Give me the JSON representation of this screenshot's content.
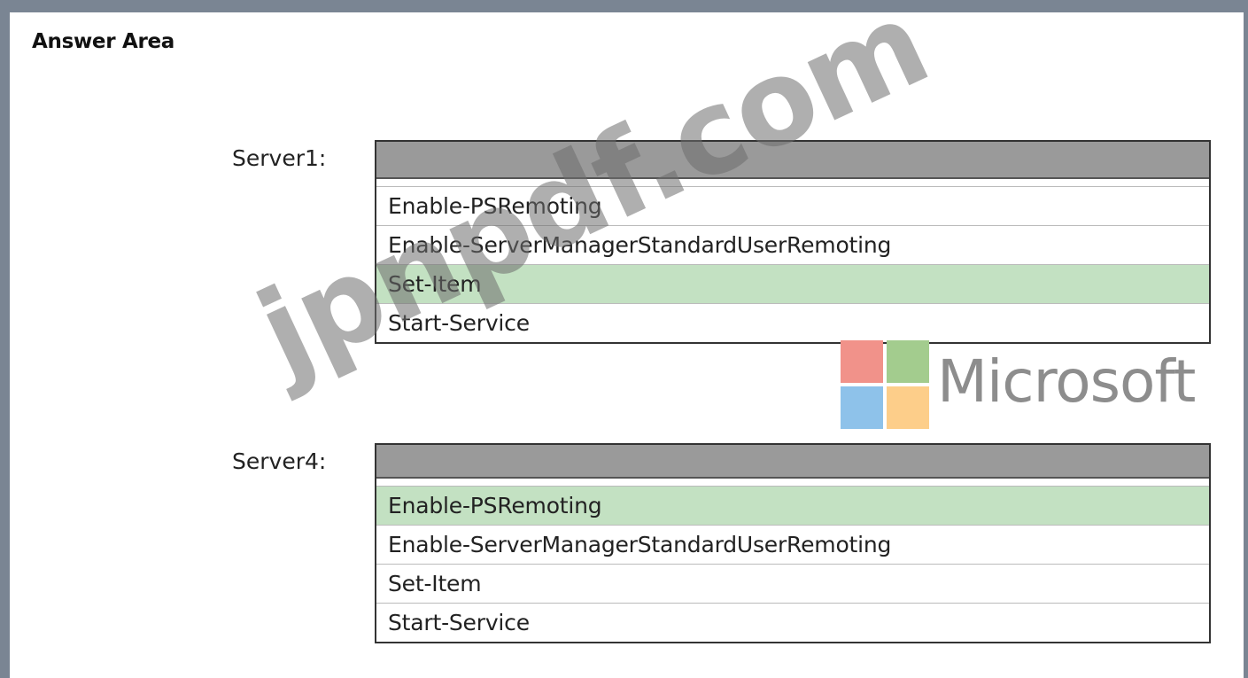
{
  "title": "Answer Area",
  "server1": {
    "label": "Server1:",
    "options": [
      "Enable-PSRemoting",
      "Enable-ServerManagerStandardUserRemoting",
      "Set-Item",
      "Start-Service"
    ],
    "selected_index": 2
  },
  "server4": {
    "label": "Server4:",
    "options": [
      "Enable-PSRemoting",
      "Enable-ServerManagerStandardUserRemoting",
      "Set-Item",
      "Start-Service"
    ],
    "selected_index": 0
  },
  "logo": {
    "wordmark": "Microsoft",
    "colors": [
      "#f1928a",
      "#a3cc8e",
      "#8ec2ea",
      "#fdce8a"
    ]
  },
  "watermark": "jpnpdf.com",
  "colors": {
    "selected_bg": "#c3e1c2",
    "header_bg": "#9a9a9a",
    "frame": "#7a8593"
  }
}
